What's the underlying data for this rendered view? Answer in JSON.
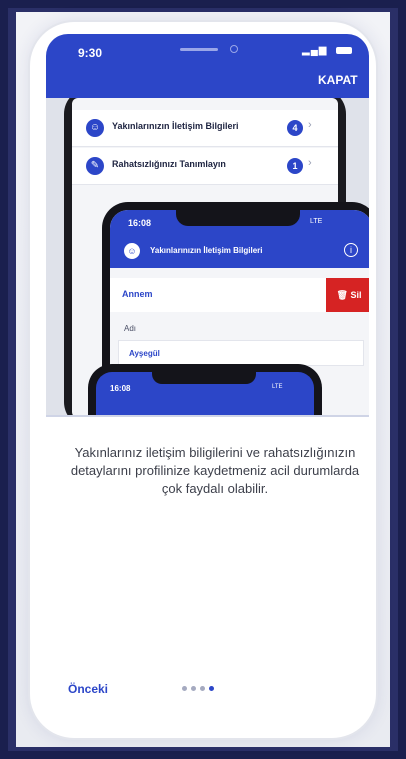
{
  "status_bar": {
    "time": "9:30"
  },
  "header": {
    "close_label": "KAPAT"
  },
  "illustration": {
    "list": [
      {
        "label": "Yakınlarınızın İletişim Bilgileri",
        "count": "4",
        "icon": "people-icon"
      },
      {
        "label": "Rahatsızlığınızı Tanımlayın",
        "count": "1",
        "icon": "pen-icon"
      }
    ],
    "detail": {
      "time": "16:08",
      "network": "LTE",
      "title": "Yakınlarınızın İletişim Bilgileri",
      "contact_name": "Annem",
      "delete_label": "Sil",
      "field_label": "Adı",
      "field_value": "Ayşegül"
    },
    "third": {
      "time": "16:08",
      "network": "LTE"
    }
  },
  "content": {
    "description": "Yakınlarınız iletişim biligilerini ve rahatsızlığınızın detaylarını profilinize kaydetmeniz acil durumlarda çok faydalı olabilir."
  },
  "footer": {
    "prev_label": "Önceki",
    "page_count": 4,
    "active_page": 4
  },
  "colors": {
    "primary": "#2c46c8",
    "danger": "#d62323",
    "background": "#1a1f4e"
  }
}
